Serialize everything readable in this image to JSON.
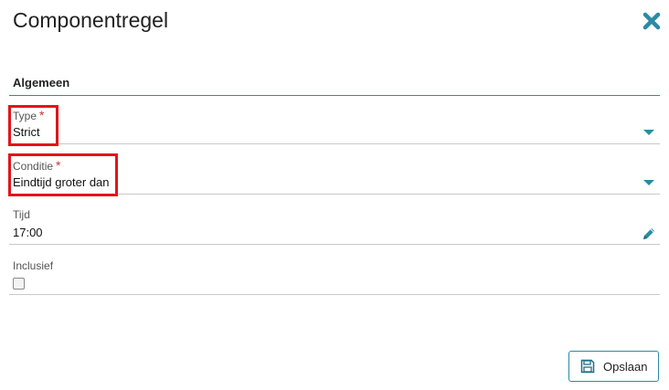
{
  "dialog": {
    "title": "Componentregel",
    "close_icon": "close-icon"
  },
  "section": {
    "title": "Algemeen"
  },
  "fields": {
    "type": {
      "label": "Type",
      "required_mark": "*",
      "value": "Strict"
    },
    "conditie": {
      "label": "Conditie",
      "required_mark": "*",
      "value": "Eindtijd groter dan"
    },
    "tijd": {
      "label": "Tijd",
      "value": "17:00"
    },
    "inclusief": {
      "label": "Inclusief",
      "checked": false
    }
  },
  "actions": {
    "save_label": "Opslaan",
    "save_icon": "floppy-disk-icon"
  },
  "colors": {
    "accent": "#2a8ba3",
    "required": "#d32f2f",
    "highlight": "#e3141b"
  }
}
